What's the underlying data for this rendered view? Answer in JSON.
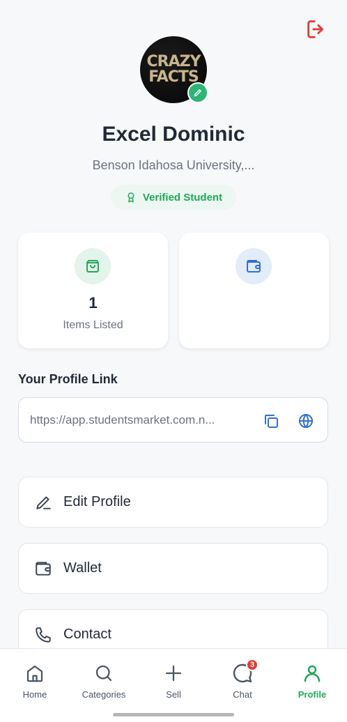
{
  "profile": {
    "avatar_text_line1": "CRAZY",
    "avatar_text_line2": "FACTS",
    "name": "Excel Dominic",
    "university": "Benson Idahosa University,...",
    "verified_label": "Verified Student"
  },
  "stats": {
    "items_listed_value": "1",
    "items_listed_label": "Items Listed",
    "wallet_value": "",
    "wallet_label": ""
  },
  "profile_link": {
    "title": "Your Profile Link",
    "url": "https://app.studentsmarket.com.n..."
  },
  "menu": [
    {
      "label": "Edit Profile",
      "icon": "edit-icon"
    },
    {
      "label": "Wallet",
      "icon": "wallet-icon"
    },
    {
      "label": "Contact",
      "icon": "phone-icon"
    }
  ],
  "nav": [
    {
      "label": "Home",
      "icon": "home-icon"
    },
    {
      "label": "Categories",
      "icon": "search-icon"
    },
    {
      "label": "Sell",
      "icon": "plus-icon"
    },
    {
      "label": "Chat",
      "icon": "chat-icon",
      "badge": "3"
    },
    {
      "label": "Profile",
      "icon": "user-icon",
      "active": true
    }
  ],
  "colors": {
    "accent_green": "#22a65b",
    "logout_red": "#e53935",
    "link_icon_blue": "#2f6fd6"
  }
}
